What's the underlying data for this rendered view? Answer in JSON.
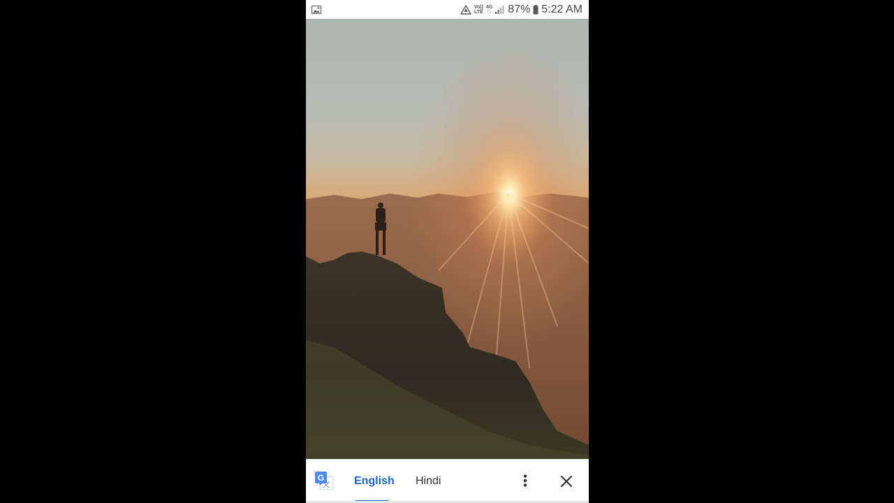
{
  "status_bar": {
    "volte_top": "Vo))",
    "volte_bottom": "LTE",
    "network_top": "4G",
    "network_bottom": "↑↓",
    "battery": "87%",
    "time": "5:22 AM",
    "icons": [
      "gallery-icon",
      "data-saver-icon",
      "volte-icon",
      "network-4g-icon",
      "signal-icon",
      "battery-icon"
    ]
  },
  "photo": {
    "subject": "hiker-on-cliff-at-sunrise"
  },
  "translate_bar": {
    "logo_icon": "google-translate-icon",
    "source_language": "English",
    "target_language": "Hindi",
    "accent": "#1a67d2",
    "more_icon": "more-vert-icon",
    "close_icon": "close-icon"
  }
}
